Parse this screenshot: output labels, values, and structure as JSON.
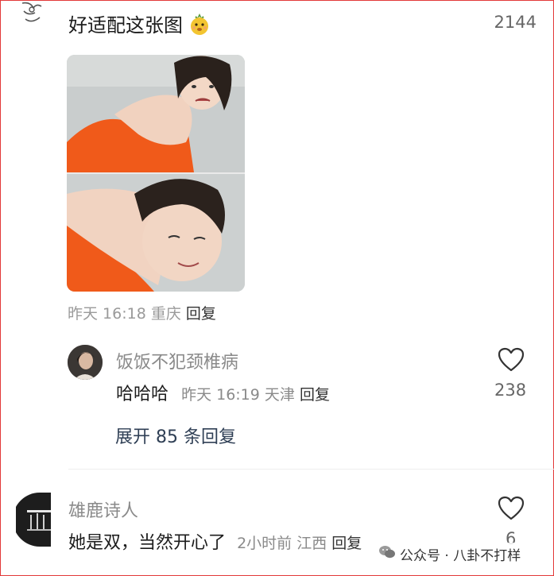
{
  "comment1": {
    "text": "好适配这张图",
    "emoji": "pineapple-face-emoji",
    "likes": "2144",
    "time": "昨天 16:18",
    "location": "重庆",
    "reply_label": "回复"
  },
  "reply1": {
    "username": "饭饭不犯颈椎病",
    "text": "哈哈哈",
    "time": "昨天 16:19",
    "location": "天津",
    "reply_label": "回复",
    "likes": "238"
  },
  "expand_label": "展开 85 条回复",
  "comment2": {
    "username": "雄鹿诗人",
    "text": "她是双，当然开心了",
    "time": "2小时前",
    "location": "江西",
    "reply_label": "回复",
    "likes": "6"
  },
  "watermark": "公众号 · 八卦不打样",
  "colors": {
    "border": "#e23a3a",
    "orange_dress": "#f05a1a",
    "expand_text": "#2f3f55"
  }
}
